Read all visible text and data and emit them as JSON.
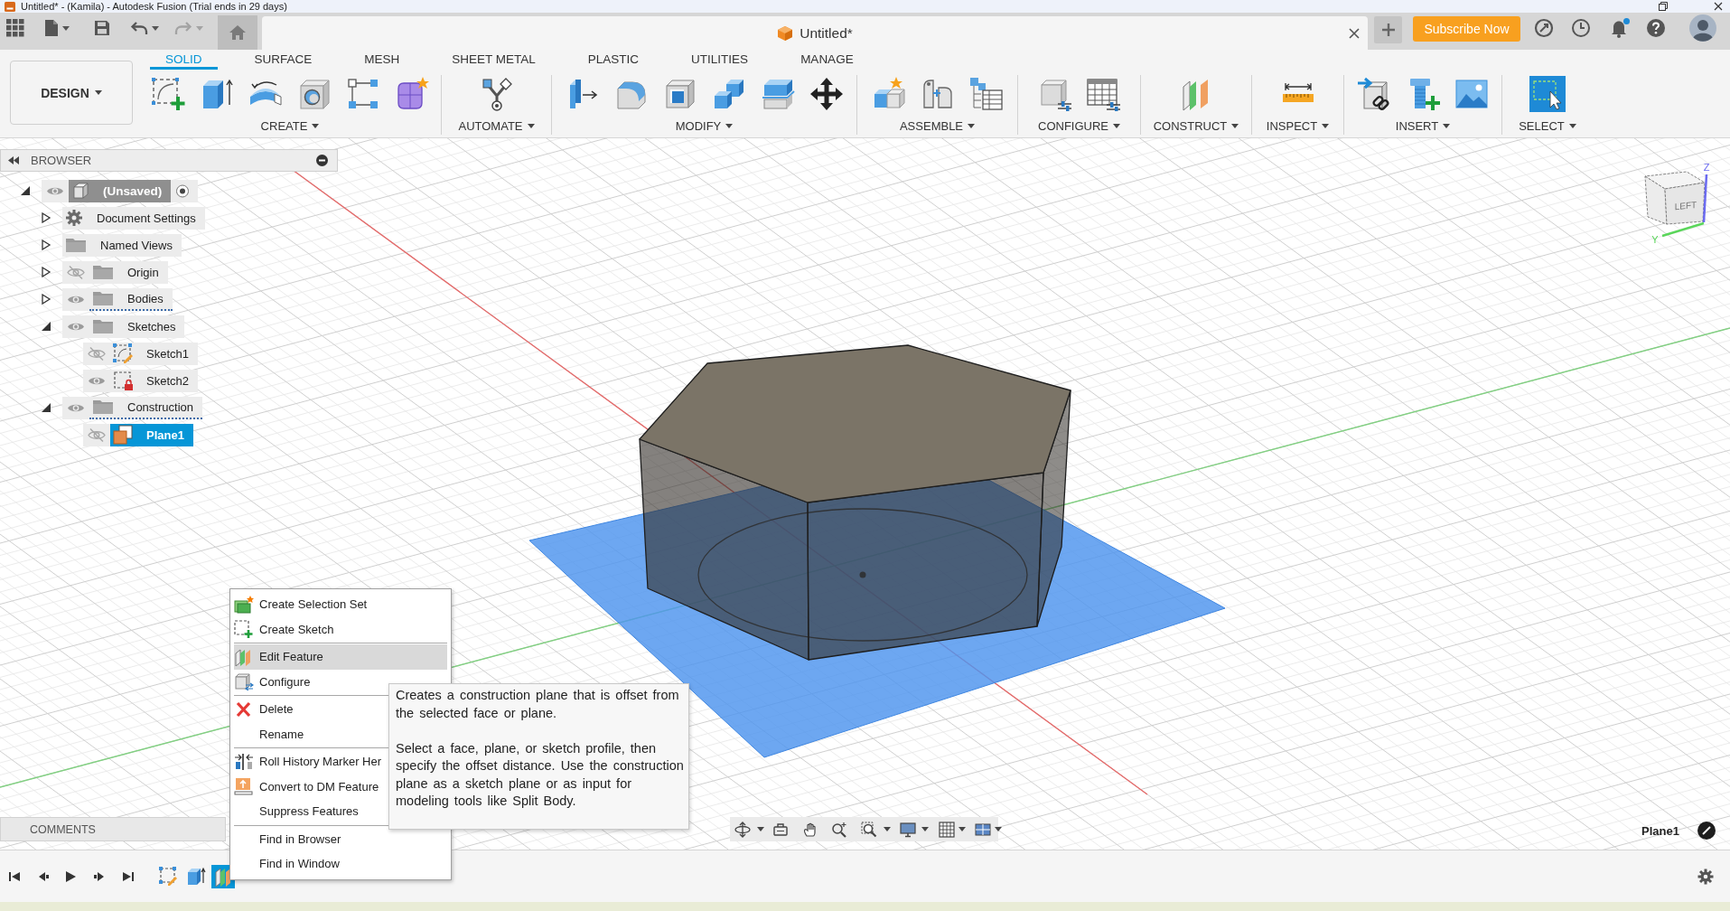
{
  "title_bar": {
    "title": "Untitled* - (Kamila) - Autodesk Fusion (Trial ends in 29 days)"
  },
  "tab_bar": {
    "undo": {
      "disabled": false
    },
    "redo": {
      "disabled": true
    },
    "document_title": "Untitled*",
    "subscribe_button": "Subscribe Now",
    "notification_badge": true
  },
  "toolbar": {
    "workspace": "DESIGN",
    "tabs": [
      {
        "label": "SOLID",
        "selected": true
      },
      {
        "label": "SURFACE",
        "selected": false
      },
      {
        "label": "MESH",
        "selected": false
      },
      {
        "label": "SHEET METAL",
        "selected": false
      },
      {
        "label": "PLASTIC",
        "selected": false
      },
      {
        "label": "UTILITIES",
        "selected": false
      },
      {
        "label": "MANAGE",
        "selected": false
      }
    ],
    "groups": [
      {
        "label": "CREATE"
      },
      {
        "label": "AUTOMATE"
      },
      {
        "label": "MODIFY"
      },
      {
        "label": "ASSEMBLE"
      },
      {
        "label": "CONFIGURE"
      },
      {
        "label": "CONSTRUCT"
      },
      {
        "label": "INSPECT"
      },
      {
        "label": "INSERT"
      },
      {
        "label": "SELECT"
      }
    ]
  },
  "browser": {
    "title": "BROWSER",
    "tree": [
      {
        "label": "(Unsaved)",
        "kind": "component",
        "expanded": true,
        "visible": true,
        "active": true,
        "selected": false,
        "children": [
          {
            "label": "Document Settings",
            "kind": "settings",
            "expanded": false,
            "selected": false
          },
          {
            "label": "Named Views",
            "kind": "folder",
            "expanded": false,
            "selected": false
          },
          {
            "label": "Origin",
            "kind": "folder",
            "expanded": false,
            "visible": false,
            "selected": false
          },
          {
            "label": "Bodies",
            "kind": "folder",
            "expanded": false,
            "visible": true,
            "dotted_underline": true,
            "selected": false
          },
          {
            "label": "Sketches",
            "kind": "folder",
            "expanded": true,
            "visible": true,
            "selected": false,
            "children": [
              {
                "label": "Sketch1",
                "kind": "sketch",
                "visible": false,
                "selected": false
              },
              {
                "label": "Sketch2",
                "kind": "locked_sketch",
                "visible": true,
                "selected": false
              }
            ]
          },
          {
            "label": "Construction",
            "kind": "folder",
            "expanded": true,
            "visible": true,
            "dotted_underline": true,
            "selected": false,
            "children": [
              {
                "label": "Plane1",
                "kind": "plane",
                "visible": false,
                "selected": true
              }
            ]
          }
        ]
      }
    ]
  },
  "view_cube": {
    "face_label": "LEFT",
    "axis_labels": [
      "Z",
      "Y"
    ]
  },
  "comments_panel": {
    "title": "COMMENTS"
  },
  "status": {
    "selection": "Plane1"
  },
  "timeline": {
    "items": [
      {
        "kind": "sketch",
        "selected": false
      },
      {
        "kind": "extrude",
        "selected": false
      },
      {
        "kind": "plane",
        "selected": true
      }
    ]
  },
  "context_menu": {
    "items": [
      {
        "label": "Create Selection Set",
        "selected": false
      },
      {
        "label": "Create Sketch",
        "selected": false
      },
      {
        "label": "Edit Feature",
        "selected": true,
        "separator_before": true
      },
      {
        "label": "Configure",
        "selected": false
      },
      {
        "label": "Delete",
        "selected": false,
        "separator_before": true
      },
      {
        "label": "Rename",
        "selected": false
      },
      {
        "label": "Roll History Marker Her",
        "selected": false,
        "separator_before": true
      },
      {
        "label": "Convert to DM Feature",
        "selected": false
      },
      {
        "label": "Suppress Features",
        "selected": false
      },
      {
        "label": "Find in Browser",
        "selected": false,
        "separator_before": true
      },
      {
        "label": "Find in Window",
        "selected": false
      }
    ]
  },
  "tooltip": {
    "paragraphs": [
      "Creates a construction plane that is offset from the selected face or plane.",
      "Select a face, plane, or sketch profile, then specify the offset distance. Use the construction plane as a sketch plane or as input for modeling tools like Split Body."
    ]
  }
}
